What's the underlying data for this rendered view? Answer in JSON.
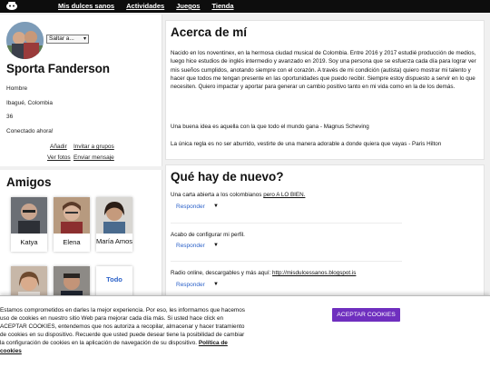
{
  "nav": {
    "items": [
      "Mis dulces sanos",
      "Actividades",
      "Juegos",
      "Tienda"
    ]
  },
  "profile": {
    "select_label": "Saltar a...",
    "name": "Sporta Fanderson",
    "gender": "Hombre",
    "location": "Ibagué, Colombia",
    "age": "36",
    "status": "Conectado ahora!",
    "links": {
      "add": "Añadir",
      "invite": "Invitar a grupos",
      "photos": "Ver fotos",
      "message": "Enviar mensaje"
    }
  },
  "friends": {
    "title": "Amigos",
    "items": [
      {
        "name": "Katya",
        "photo_icon": "friend-photo-man-glasses"
      },
      {
        "name": "Elena",
        "photo_icon": "friend-photo-woman-glasses"
      },
      {
        "name": "María Amos",
        "photo_icon": "friend-photo-woman"
      },
      {
        "name": "",
        "photo_icon": "friend-photo-woman-smiling"
      },
      {
        "name": "",
        "photo_icon": "friend-photo-man"
      },
      {
        "name": "Todo"
      }
    ]
  },
  "about": {
    "title": "Acerca de mí",
    "bio": "Nacido en los noventinex, en la hermosa ciudad musical de Colombia. Entre 2016 y 2017 estudié producción de medios, luego hice estudios de inglés intermedio y avanzado en 2019. Soy una persona que se esfuerza cada día para lograr ver mis sueños cumplidos, anotando siempre con el corazón. A través de mi condición (autista) quiero mostrar mi talento y hacer que todos me tengan presente en las oportunidades que puedo recibir. Siempre estoy dispuesto a servir en lo que necesiten. Quiero impactar y aportar para generar un cambio positivo tanto en mi vida como en la de los demás.",
    "quote1": "Una buena idea es aquella con la que todo el mundo gana - Magnus Scheving",
    "quote2": "La única regla es no ser aburrido, vestirte de una manera adorable a donde quiera que vayas - Paris Hilton"
  },
  "news": {
    "title": "Qué hay de nuevo?",
    "reply_label": "Responder",
    "posts": [
      {
        "text": "Una carta abierta a los colombianos",
        "link": "pero A LO BIEN."
      },
      {
        "text": "Acabo de configurar mi perfil.",
        "link": ""
      },
      {
        "text": "Radio online, descargables y más aquí:",
        "link": "http://misdulcessanos.blogspot.is"
      }
    ]
  },
  "cookie": {
    "text": "Estamos comprometidos en darles la mejor experiencia. Por eso, les informamos que hacemos uso de cookies en nuestro sitio Web para mejorar cada día más. Si usted hace click en ACEPTAR COOKIES, entendemos que nos autoriza a recopilar, almacenar y hacer tratamiento de cookies en su dispositivo. Recuerde que usted puede desear tiene la posibilidad de cambiar la configuración de cookies en la aplicación de navegación de su dispositivo.",
    "policy_link": "Política de cookies",
    "accept_label": "ACEPTAR COOKIES"
  },
  "colors": {
    "accent": "#6f2fbf",
    "link_blue": "#2c62c9",
    "nav_bg": "#0d0d0d"
  },
  "icons": {
    "logo": "site-logo-icon",
    "select_arrow": "chevron-down-icon",
    "reply_caret": "caret-down-icon"
  }
}
